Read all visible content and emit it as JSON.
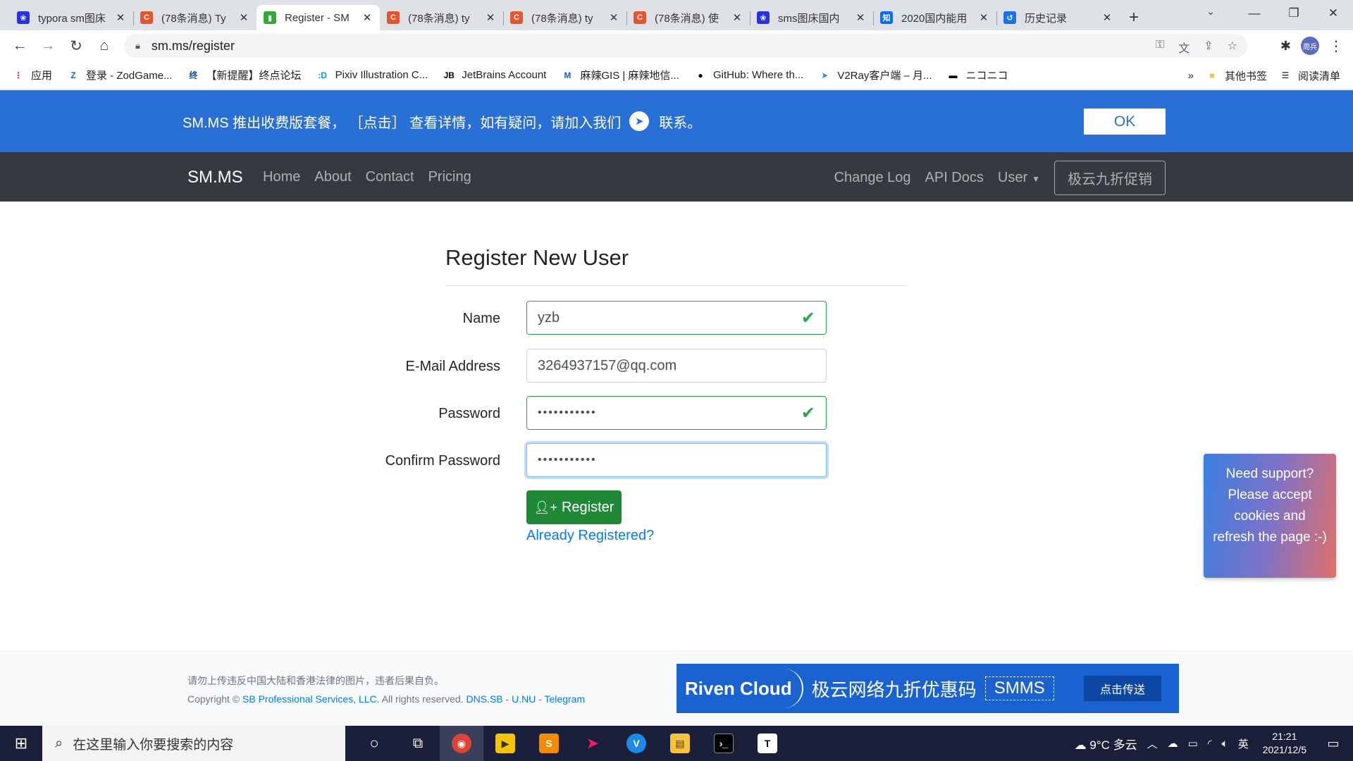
{
  "browser": {
    "tabs": [
      {
        "title": "typora sm图床",
        "color": "#2932e1",
        "glyph": "❀",
        "active": false
      },
      {
        "title": "(78条消息) Ty",
        "color": "#e8542b",
        "glyph": "C",
        "active": false
      },
      {
        "title": "Register - SM",
        "color": "#3a3",
        "glyph": "▮",
        "active": true
      },
      {
        "title": "(78条消息) ty",
        "color": "#e8542b",
        "glyph": "C",
        "active": false
      },
      {
        "title": "(78条消息) ty",
        "color": "#e8542b",
        "glyph": "C",
        "active": false
      },
      {
        "title": "(78条消息) 使",
        "color": "#e8542b",
        "glyph": "C",
        "active": false
      },
      {
        "title": "sms图床国内",
        "color": "#2932e1",
        "glyph": "❀",
        "active": false
      },
      {
        "title": "2020国内能用",
        "color": "#0a6cff",
        "glyph": "知",
        "active": false
      },
      {
        "title": "历史记录",
        "color": "#1a73e8",
        "glyph": "↺",
        "active": false
      }
    ],
    "url": "sm.ms/register",
    "profile_initials": "周兵",
    "bookmarks": [
      {
        "label": "应用",
        "color": "#e53935",
        "glyph": "⋮"
      },
      {
        "label": "登录 - ZodGame...",
        "color": "#1565c0",
        "glyph": "Z"
      },
      {
        "label": "【新提醒】终点论坛",
        "color": "#0d47a1",
        "glyph": "终"
      },
      {
        "label": "Pixiv Illustration C...",
        "color": "#0096fa",
        "glyph": ":D"
      },
      {
        "label": "JetBrains Account",
        "color": "#000",
        "glyph": "JB"
      },
      {
        "label": "麻辣GIS | 麻辣地信...",
        "color": "#1565c0",
        "glyph": "M"
      },
      {
        "label": "GitHub: Where th...",
        "color": "#000",
        "glyph": "●"
      },
      {
        "label": "V2Ray客户端 – 月...",
        "color": "#1e88e5",
        "glyph": "➤"
      },
      {
        "label": "ニコニコ",
        "color": "#000",
        "glyph": "▬"
      }
    ],
    "bookmarks_more": "»",
    "other_bookmarks": "其他书签",
    "reading_list": "阅读清单"
  },
  "notice": {
    "text_before": "SM.MS 推出收费版套餐， ［点击］ 查看详情，如有疑问，请加入我们",
    "text_after": "联系。",
    "ok_label": "OK"
  },
  "navbar": {
    "brand": "SM.MS",
    "left_links": [
      "Home",
      "About",
      "Contact",
      "Pricing"
    ],
    "right_links": [
      "Change Log",
      "API Docs"
    ],
    "user_menu": "User",
    "promo_button": "极云九折促销"
  },
  "form": {
    "title": "Register New User",
    "fields": [
      {
        "label": "Name",
        "value": "yzb",
        "state": "valid"
      },
      {
        "label": "E-Mail Address",
        "value": "3264937157@qq.com",
        "state": "normal"
      },
      {
        "label": "Password",
        "value": "•••••••••••",
        "state": "valid"
      },
      {
        "label": "Confirm Password",
        "value": "•••••••••••",
        "state": "focus"
      }
    ],
    "register_label": "Register",
    "already_link": "Already Registered?"
  },
  "support_popup": "Need support? Please accept cookies and refresh the page :-)",
  "footer": {
    "warning": "请勿上传违反中国大陆和香港法律的图片，违者后果自负。",
    "copyright": "Copyright ©",
    "company": "SB Professional Services, LLC.",
    "rights": " All rights reserved.",
    "link1": "DNS.SB",
    "sep": " - ",
    "link2": "U.NU",
    "link3": "Telegram"
  },
  "ad_banner": {
    "brand": "Riven Cloud",
    "text": "极云网络九折优惠码",
    "code": "SMMS",
    "button": "点击传送"
  },
  "taskbar": {
    "search_placeholder": "在这里输入你要搜索的内容",
    "weather": "9°C 多云",
    "ime": "英",
    "time": "21:21",
    "date": "2021/12/5"
  }
}
